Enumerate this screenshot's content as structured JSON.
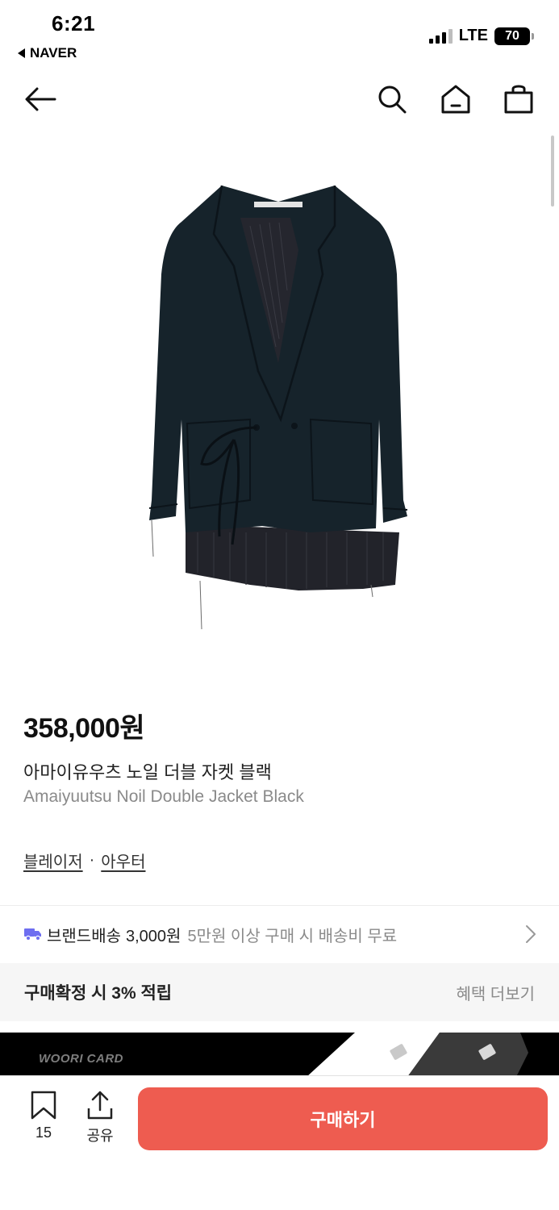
{
  "status_bar": {
    "time": "6:21",
    "back_app": "NAVER",
    "network": "LTE",
    "battery": "70"
  },
  "nav": {
    "icons": [
      "back-arrow-icon",
      "search-icon",
      "home-icon",
      "shopping-bag-icon"
    ]
  },
  "product": {
    "image_description": "jacket",
    "price": "358,000원",
    "name_ko": "아마이유우츠 노일 더블 자켓 블랙",
    "name_en": "Amaiyuutsu Noil Double Jacket Black",
    "categories": [
      "블레이저",
      "아우터"
    ],
    "category_separator": "·"
  },
  "shipping": {
    "label": "브랜드배송",
    "fee": "3,000원",
    "note": "5만원 이상 구매 시 배송비 무료"
  },
  "reward": {
    "text": "구매확정 시 3% 적립",
    "more": "혜택 더보기"
  },
  "banner": {
    "brand": "WOORI CARD"
  },
  "bottom_bar": {
    "bookmark_count": "15",
    "share_label": "공유",
    "buy_label": "구매하기"
  },
  "colors": {
    "buy_button": "#ee5c50",
    "truck_icon": "#6e6ef0",
    "jacket": "#16232b"
  }
}
